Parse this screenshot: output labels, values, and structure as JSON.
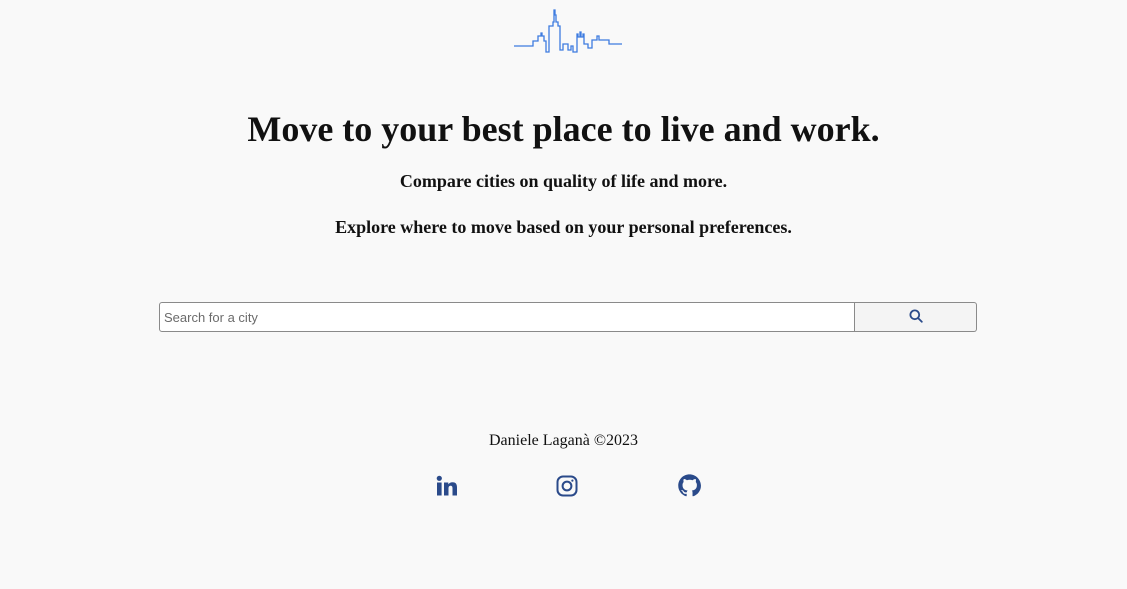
{
  "header": {
    "logo_icon": "city-skyline-icon",
    "logo_color": "#3d7be0"
  },
  "hero": {
    "headline": "Move to your best place to live and work.",
    "subtitle_1": "Compare cities on quality of life and more.",
    "subtitle_2": "Explore where to move based on your personal preferences."
  },
  "search": {
    "placeholder": "Search for a city",
    "value": "",
    "button_icon": "search-icon"
  },
  "footer": {
    "copyright": "Daniele Laganà ©2023",
    "social_links": [
      {
        "name": "linkedin",
        "icon": "linkedin-icon"
      },
      {
        "name": "instagram",
        "icon": "instagram-icon"
      },
      {
        "name": "github",
        "icon": "github-icon"
      }
    ],
    "icon_color": "#2a4a8a"
  }
}
